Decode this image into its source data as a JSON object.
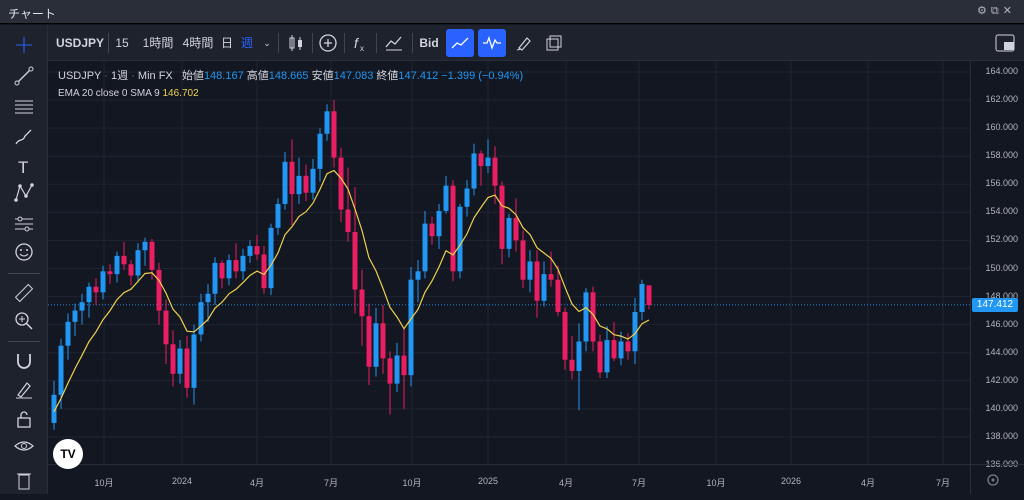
{
  "window": {
    "title": "チャート"
  },
  "toolbar": {
    "symbol": "USDJPY",
    "intervals": [
      "15分",
      "1時間",
      "4時間",
      "日",
      "週"
    ],
    "active_interval": "週",
    "bid": "Bid"
  },
  "legend": {
    "symbol": "USDJPY",
    "interval": "1週",
    "source": "Min FX",
    "open_label": "始値",
    "open": "148.167",
    "high_label": "高値",
    "high": "148.665",
    "low_label": "安値",
    "low": "147.083",
    "close_label": "終値",
    "close": "147.412",
    "change": "−1.399 (−0.94%)",
    "indicator": "EMA 20 close 0 SMA 9",
    "indicator_value": "146.702"
  },
  "price_axis": {
    "ticks": [
      "164.000",
      "162.000",
      "160.000",
      "158.000",
      "156.000",
      "154.000",
      "152.000",
      "150.000",
      "148.000",
      "146.000",
      "144.000",
      "142.000",
      "140.000",
      "138.000",
      "136.000"
    ],
    "current_price": "147.412"
  },
  "time_axis": {
    "ticks": [
      "10月",
      "2024",
      "4月",
      "7月",
      "10月",
      "2025",
      "4月",
      "7月",
      "10月",
      "2026",
      "4月",
      "7月"
    ]
  },
  "colors": {
    "up": "#2196f3",
    "down": "#e91e63",
    "ema": "#f0d04c",
    "background": "#131722"
  },
  "chart_data": {
    "type": "candlestick",
    "interval": "1週",
    "ylim": [
      136,
      164
    ],
    "candles": [
      [
        139,
        142,
        138.5,
        141
      ],
      [
        141,
        145,
        140,
        144.5
      ],
      [
        144.5,
        146.8,
        143.5,
        146.2
      ],
      [
        146.2,
        147.5,
        145.2,
        147
      ],
      [
        147,
        148.2,
        146,
        147.6
      ],
      [
        147.6,
        149,
        146.5,
        148.7
      ],
      [
        148.7,
        149.3,
        147.4,
        148.3
      ],
      [
        148.3,
        150.2,
        147.8,
        149.8
      ],
      [
        149.8,
        150.3,
        148.9,
        149.6
      ],
      [
        149.6,
        151.2,
        149,
        150.9
      ],
      [
        150.9,
        151.9,
        149.9,
        150.3
      ],
      [
        150.3,
        150.6,
        148.8,
        149.5
      ],
      [
        149.5,
        151.8,
        149,
        151.3
      ],
      [
        151.3,
        152.2,
        150.2,
        151.9
      ],
      [
        151.9,
        152.1,
        149.2,
        149.9
      ],
      [
        149.9,
        150.4,
        146,
        147
      ],
      [
        147,
        147.8,
        143.2,
        144.6
      ],
      [
        144.6,
        145.6,
        141.6,
        142.5
      ],
      [
        142.5,
        144.9,
        141.8,
        144.3
      ],
      [
        144.3,
        145.2,
        140.8,
        141.5
      ],
      [
        141.5,
        146,
        140.3,
        145.3
      ],
      [
        145.3,
        148.2,
        144.8,
        147.6
      ],
      [
        147.6,
        148.9,
        146.2,
        148.2
      ],
      [
        148.2,
        150.8,
        147.4,
        150.4
      ],
      [
        150.4,
        150.6,
        148.6,
        149.3
      ],
      [
        149.3,
        151,
        148.8,
        150.6
      ],
      [
        150.6,
        151.8,
        149.3,
        149.8
      ],
      [
        149.8,
        151.4,
        149.2,
        150.9
      ],
      [
        150.9,
        152,
        150.4,
        151.6
      ],
      [
        151.6,
        152.4,
        150.6,
        151
      ],
      [
        151,
        151.6,
        148.2,
        148.6
      ],
      [
        148.6,
        153.2,
        148.1,
        152.9
      ],
      [
        152.9,
        155,
        152.4,
        154.6
      ],
      [
        154.6,
        158.3,
        154.2,
        157.6
      ],
      [
        157.6,
        159.2,
        153.1,
        155.3
      ],
      [
        155.3,
        157.9,
        154.6,
        156.6
      ],
      [
        156.6,
        157.4,
        154.8,
        155.4
      ],
      [
        155.4,
        157.8,
        154.9,
        157.1
      ],
      [
        157.1,
        160,
        156.2,
        159.6
      ],
      [
        159.6,
        161.7,
        159.1,
        161.2
      ],
      [
        161.2,
        162,
        157.2,
        157.9
      ],
      [
        157.9,
        158.6,
        153.3,
        154.2
      ],
      [
        154.2,
        157.2,
        151.9,
        152.6
      ],
      [
        152.6,
        155.8,
        146.8,
        148.5
      ],
      [
        148.5,
        149.9,
        144.5,
        146.6
      ],
      [
        146.6,
        147.5,
        141.7,
        143
      ],
      [
        143,
        147.2,
        142.3,
        146.1
      ],
      [
        146.1,
        147.4,
        142.5,
        143.6
      ],
      [
        143.6,
        144.1,
        139.6,
        141.8
      ],
      [
        141.8,
        144.7,
        141.2,
        143.8
      ],
      [
        143.8,
        145.8,
        140,
        142.4
      ],
      [
        142.4,
        150.1,
        141.6,
        149.2
      ],
      [
        149.2,
        150.6,
        147.6,
        149.8
      ],
      [
        149.8,
        154.1,
        149.3,
        153.2
      ],
      [
        153.2,
        153.7,
        151.7,
        152.3
      ],
      [
        152.3,
        154.6,
        151.4,
        154.1
      ],
      [
        154.1,
        156.6,
        153.9,
        155.9
      ],
      [
        155.9,
        156.3,
        149.1,
        149.8
      ],
      [
        149.8,
        154.6,
        149.3,
        154.4
      ],
      [
        154.4,
        156.3,
        153.7,
        155.7
      ],
      [
        155.7,
        158.9,
        155.2,
        158.2
      ],
      [
        158.2,
        158.4,
        155.9,
        157.3
      ],
      [
        157.3,
        159.2,
        156.8,
        157.9
      ],
      [
        157.9,
        158.7,
        154.6,
        155.9
      ],
      [
        155.9,
        156.2,
        150.3,
        151.4
      ],
      [
        151.4,
        153.9,
        150.8,
        153.6
      ],
      [
        153.6,
        155,
        151.2,
        152
      ],
      [
        152,
        152.7,
        148.6,
        149.2
      ],
      [
        149.2,
        151.3,
        148.3,
        150.5
      ],
      [
        150.5,
        151.3,
        146.5,
        147.7
      ],
      [
        147.7,
        150.5,
        147.3,
        149.6
      ],
      [
        149.6,
        151.2,
        148.7,
        149.2
      ],
      [
        149.2,
        150.2,
        146.6,
        146.9
      ],
      [
        146.9,
        147.2,
        142.8,
        143.5
      ],
      [
        143.5,
        145.2,
        142.1,
        142.7
      ],
      [
        142.7,
        146.1,
        139.9,
        144.8
      ],
      [
        144.8,
        148.6,
        144.1,
        148.3
      ],
      [
        148.3,
        148.7,
        144.1,
        144.8
      ],
      [
        144.8,
        145.3,
        142.2,
        142.6
      ],
      [
        142.6,
        145.9,
        142.2,
        144.9
      ],
      [
        144.9,
        146.2,
        143.4,
        143.6
      ],
      [
        143.6,
        145.5,
        143.1,
        144.8
      ],
      [
        144.8,
        145.4,
        143.5,
        144.1
      ],
      [
        144.1,
        147.9,
        143.2,
        146.9
      ],
      [
        146.9,
        149.2,
        146.3,
        148.9
      ],
      [
        148.8,
        148.7,
        147.1,
        147.4
      ]
    ]
  }
}
